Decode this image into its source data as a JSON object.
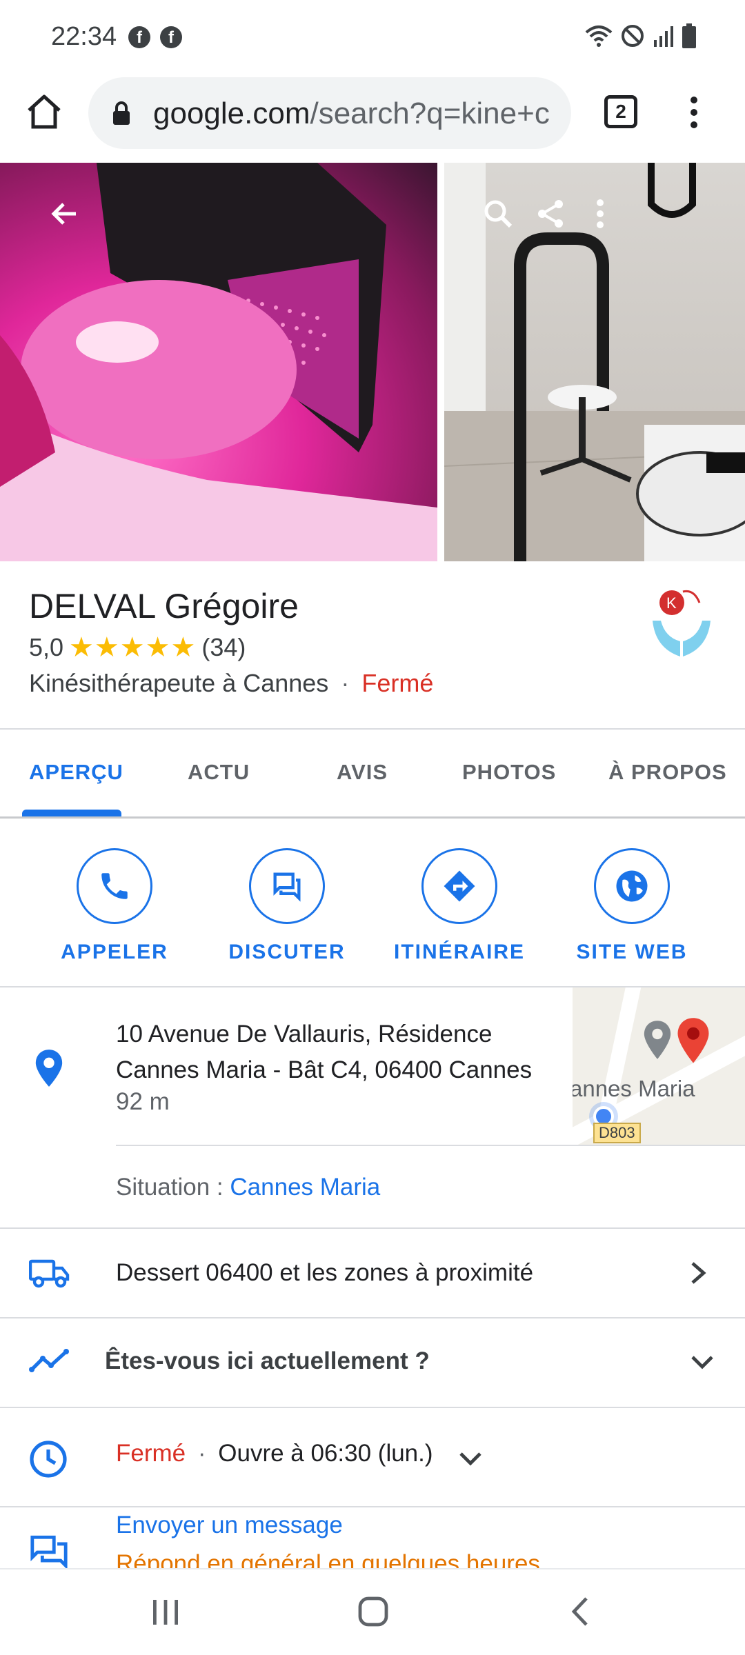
{
  "status": {
    "time": "22:34",
    "notif_icons": [
      "facebook-icon",
      "facebook-icon"
    ],
    "right_icons": [
      "wifi-icon",
      "do-not-disturb-icon",
      "signal-icon",
      "battery-icon"
    ]
  },
  "browser": {
    "url_domain": "google.com",
    "url_rest": "/search?q=kine+c",
    "tab_count": "2"
  },
  "business": {
    "name": "DELVAL Grégoire",
    "rating": "5,0",
    "stars": "★★★★★",
    "review_count": "(34)",
    "category": "Kinésithérapeute à Cannes",
    "dot": "·",
    "status": "Fermé"
  },
  "tabs": [
    {
      "label": "APERÇU",
      "active": true
    },
    {
      "label": "ACTU"
    },
    {
      "label": "AVIS"
    },
    {
      "label": "PHOTOS"
    },
    {
      "label": "À PROPOS"
    }
  ],
  "actions": [
    {
      "label": "APPELER",
      "icon": "phone-icon"
    },
    {
      "label": "DISCUTER",
      "icon": "chat-icon"
    },
    {
      "label": "ITINÉRAIRE",
      "icon": "directions-icon"
    },
    {
      "label": "SITE WEB",
      "icon": "globe-icon"
    }
  ],
  "address": {
    "line1": "10 Avenue De Vallauris, Résidence",
    "line2": "Cannes Maria - Bât C4, 06400 Cannes",
    "distance": "92 m",
    "situation_label": "Situation : ",
    "situation_link": "Cannes Maria",
    "map_label": "annes Maria",
    "map_route": "D803"
  },
  "service_area": "Dessert 06400 et les zones à proximité",
  "here_question": "Êtes-vous ici actuellement ?",
  "hours": {
    "status": "Fermé",
    "dot": "·",
    "next": "Ouvre à 06:30 (lun.)"
  },
  "message": {
    "label": "Envoyer un message",
    "subtext": "Répond en général en quelques heures"
  },
  "colors": {
    "accent": "#1a73e8",
    "closed": "#d93025",
    "star": "#fbbc04",
    "reply": "#e37400"
  }
}
